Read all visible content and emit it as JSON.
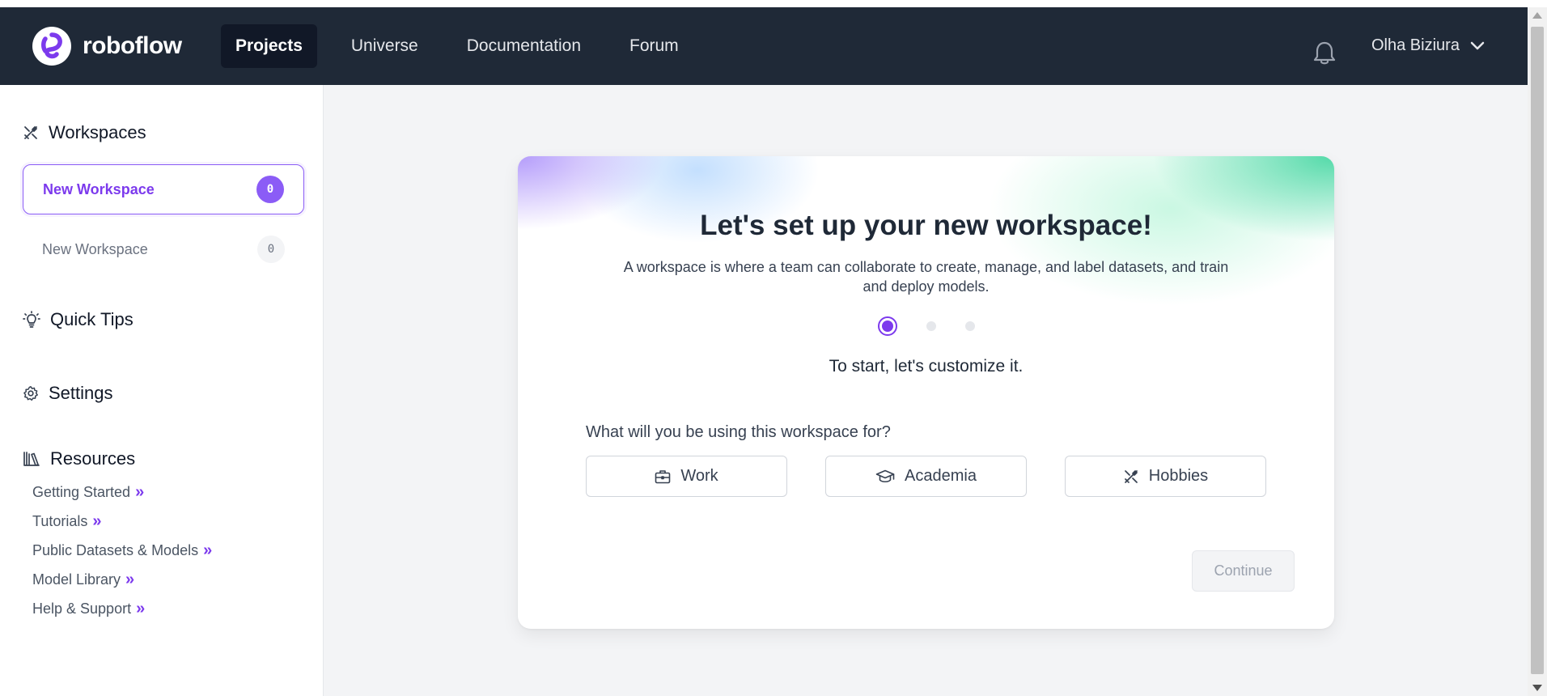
{
  "brand": {
    "name": "roboflow"
  },
  "nav": {
    "items": [
      {
        "label": "Projects",
        "active": true
      },
      {
        "label": "Universe"
      },
      {
        "label": "Documentation"
      },
      {
        "label": "Forum"
      }
    ],
    "user_name": "Olha Biziura"
  },
  "sidebar": {
    "workspaces_title": "Workspaces",
    "workspaces": [
      {
        "label": "New Workspace",
        "count": "0",
        "selected": true
      },
      {
        "label": "New Workspace",
        "count": "0"
      }
    ],
    "quick_tips": "Quick Tips",
    "settings": "Settings",
    "resources_title": "Resources",
    "resources": [
      {
        "label": "Getting Started"
      },
      {
        "label": "Tutorials"
      },
      {
        "label": "Public Datasets & Models"
      },
      {
        "label": "Model Library"
      },
      {
        "label": "Help & Support"
      }
    ]
  },
  "setup": {
    "title": "Let's set up your new workspace!",
    "description": "A workspace is where a team can collaborate to create, manage, and label datasets, and train and deploy models.",
    "step_current": 1,
    "step_total": 3,
    "subtitle": "To start, let's customize it.",
    "question": "What will you be using this workspace for?",
    "options": [
      {
        "label": "Work",
        "icon": "briefcase-icon"
      },
      {
        "label": "Academia",
        "icon": "graduation-cap-icon"
      },
      {
        "label": "Hobbies",
        "icon": "tools-icon"
      }
    ],
    "continue_label": "Continue"
  },
  "colors": {
    "navbar": "#1f2937",
    "accent": "#7c3aed",
    "page_bg": "#f3f4f6"
  }
}
